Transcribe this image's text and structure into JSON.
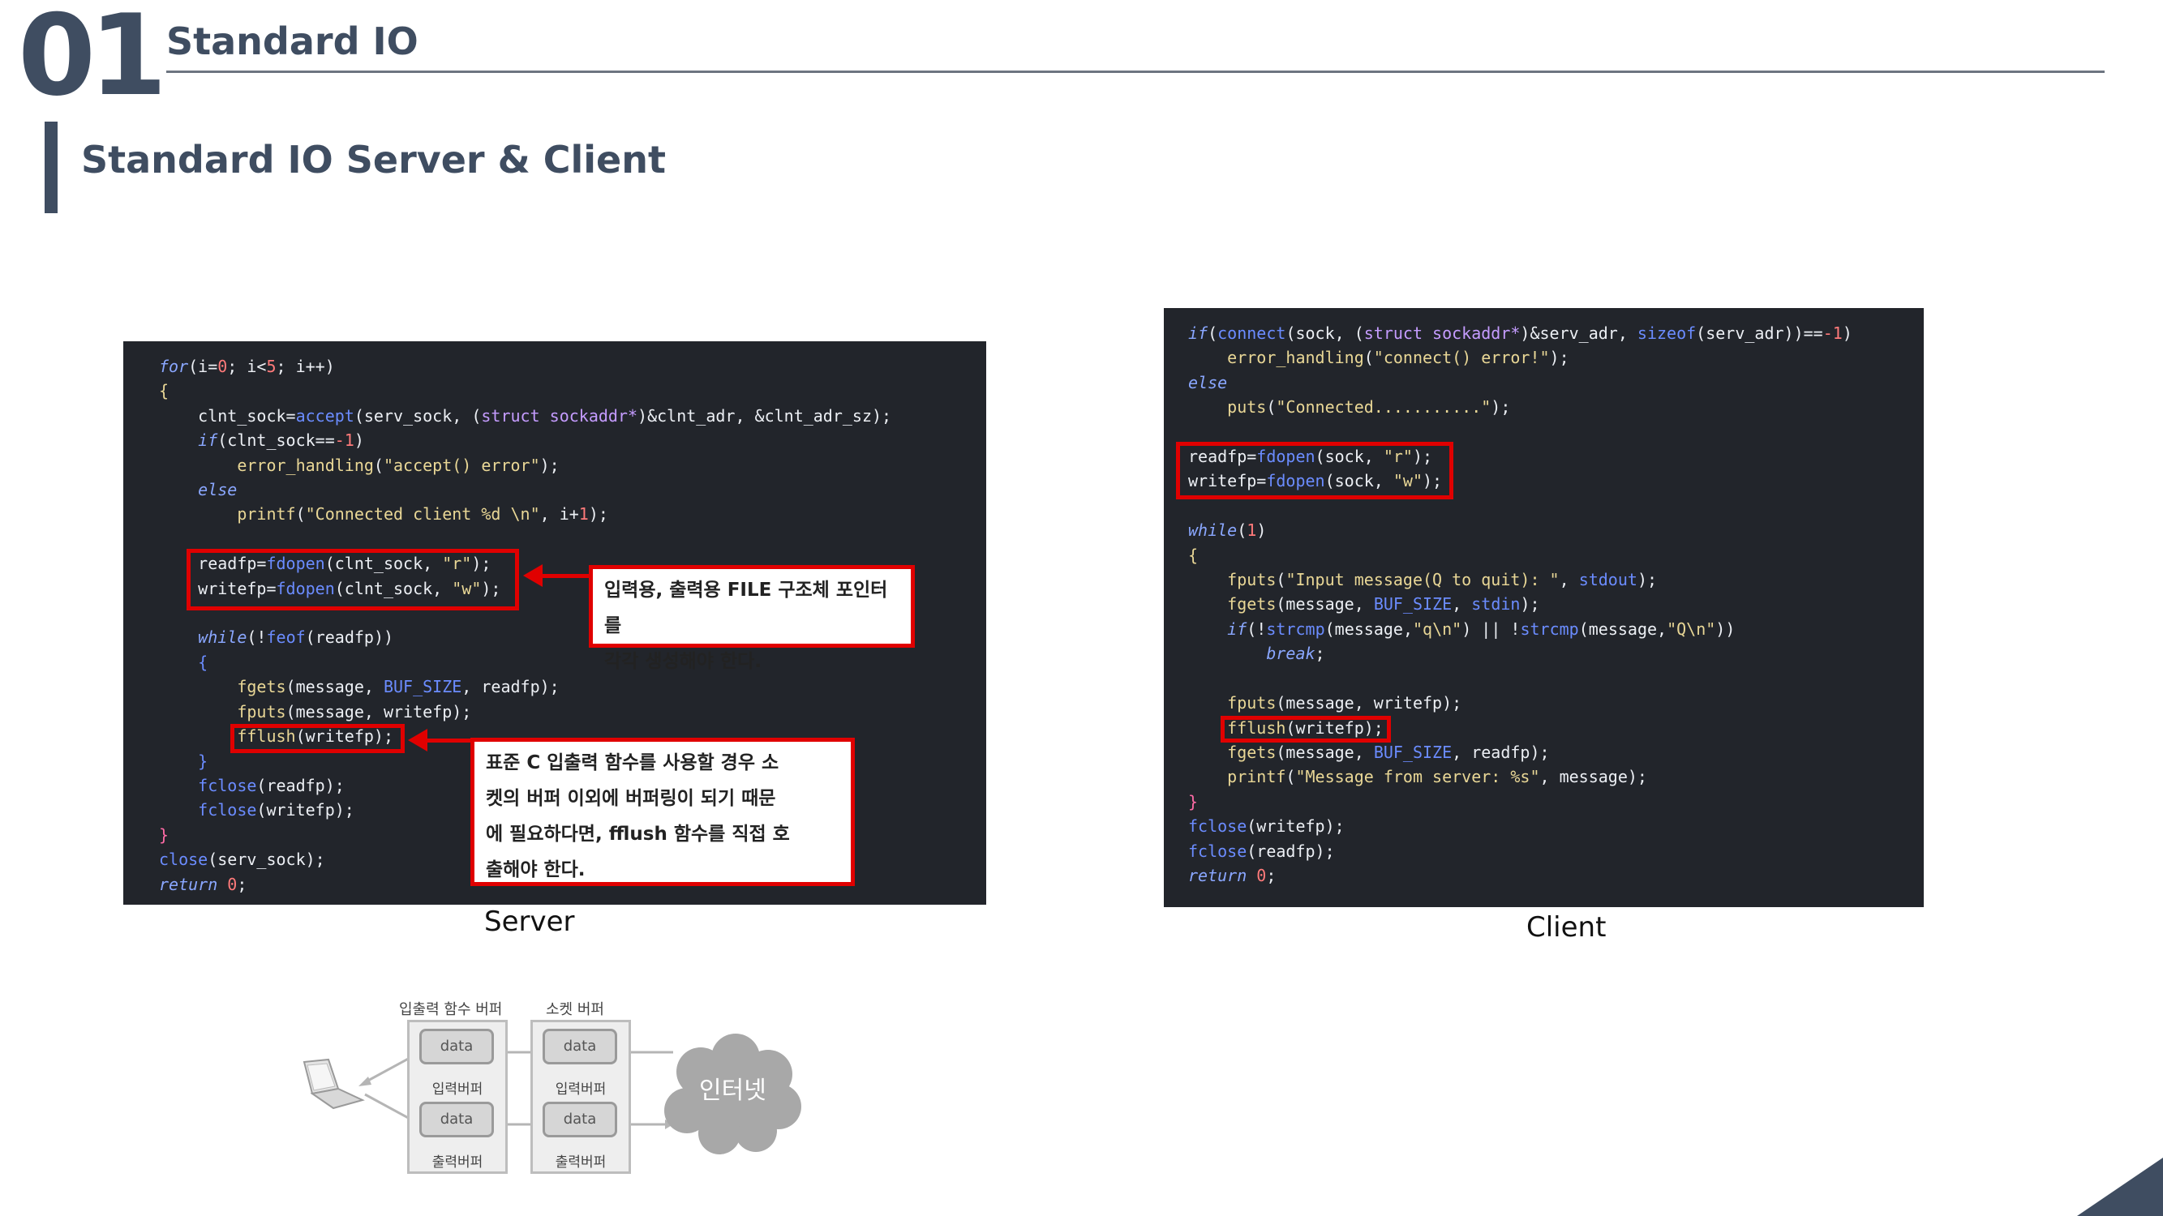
{
  "header": {
    "section_number": "01",
    "section_title": "Standard IO",
    "subtitle": "Standard IO Server & Client"
  },
  "server": {
    "caption": "Server",
    "callout_1": [
      "입력용, 출력용 FILE 구조체 포인터를",
      "각각 생성해야 한다."
    ],
    "callout_2": [
      "표준 C 입출력 함수를 사용할 경우 소",
      "켓의 버퍼 이외에 버퍼링이 되기 때문",
      "에 필요하다면, fflush 함수를 직접 호",
      "출해야 한다."
    ]
  },
  "client": {
    "caption": "Client"
  },
  "diagram": {
    "io_buffer_label": "입출력 함수 버퍼",
    "socket_buffer_label": "소켓 버퍼",
    "data_label": "data",
    "input_buffer_label": "입력버퍼",
    "output_buffer_label": "출력버퍼",
    "internet_label": "인터넷"
  },
  "colors": {
    "header": "#3f4d61",
    "highlight": "#e00000",
    "code_bg": "#22252b"
  }
}
